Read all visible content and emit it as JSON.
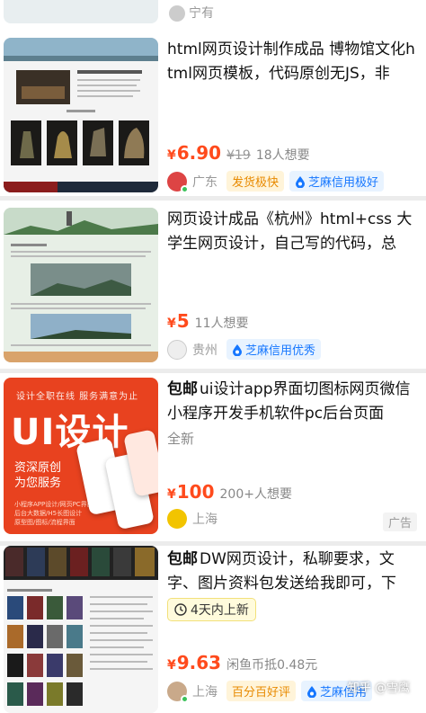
{
  "top_stub": {
    "text": "宁有"
  },
  "items": [
    {
      "title": "html网页设计制作成品 博物馆文化html网页模板，代码原创无JS，非",
      "price_symbol": "¥",
      "price": "6.90",
      "orig_price": "¥19",
      "wants": "18人想要",
      "location": "广东",
      "badge1": "发货极快",
      "badge2": "芝麻信用极好"
    },
    {
      "title": "网页设计成品《杭州》html+css 大学生网页设计，自己写的代码，总",
      "price_symbol": "¥",
      "price": "5",
      "wants": "11人想要",
      "location": "贵州",
      "badge2": "芝麻信用优秀"
    },
    {
      "tag": "包邮",
      "title": "ui设计app界面切图标网页微信小程序开发手机软件pc后台页面",
      "condition": "全新",
      "price_symbol": "¥",
      "price": "100",
      "wants": "200+人想要",
      "location": "上海",
      "ad_label": "广告",
      "thumb": {
        "top": "设计全职在线  服务满意为止",
        "big": "UI设计",
        "line1": "资深原创",
        "line2": "为您服务",
        "small1": "小程序APP设计/网页PC界面",
        "small2": "后台大数据/H5长图设计",
        "small3": "原型图/图标/流程界面"
      }
    },
    {
      "tag": "包邮",
      "title": "DW网页设计，私聊要求，文字、图片资料包发送给我即可，下",
      "time_chip": "4天内上新",
      "price_symbol": "¥",
      "price": "9.63",
      "extra": "闲鱼币抵0.48元",
      "location": "上海",
      "badge1": "百分百好评",
      "badge2": "芝麻信用"
    }
  ],
  "watermark": "知乎 @雪鹰",
  "colors": {
    "price": "#ff4a1c",
    "credit": "#1677ff",
    "ship": "#e88a00"
  }
}
